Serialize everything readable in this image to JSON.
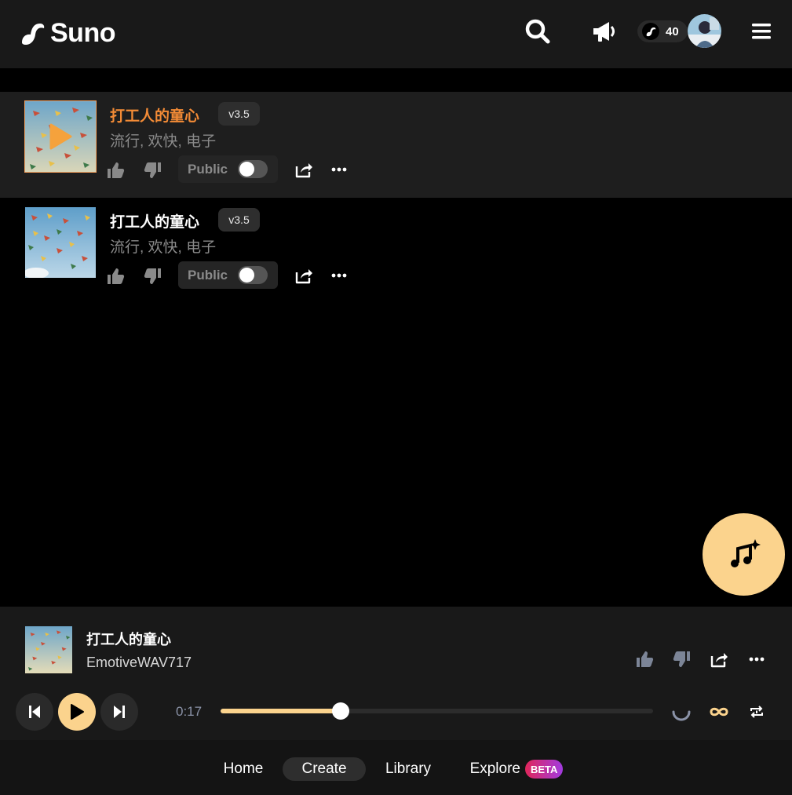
{
  "header": {
    "brand": "Suno",
    "credits": "40",
    "icons": [
      "search-icon",
      "megaphone-icon",
      "menu-icon"
    ]
  },
  "songs": [
    {
      "title": "打工人的童心",
      "version": "v3.5",
      "tags": "流行, 欢快, 电子",
      "visibility_label": "Public",
      "is_public": false,
      "selected": true
    },
    {
      "title": "打工人的童心",
      "version": "v3.5",
      "tags": "流行, 欢快, 电子",
      "visibility_label": "Public",
      "is_public": false,
      "selected": false
    }
  ],
  "player": {
    "title": "打工人的童心",
    "artist": "EmotiveWAV717",
    "current_time": "0:17",
    "progress_fraction": 0.277
  },
  "nav": {
    "items": [
      "Home",
      "Create",
      "Library",
      "Explore"
    ],
    "active": "Create",
    "beta_badge": "BETA"
  },
  "colors": {
    "accent": "#fbd38d",
    "active_title": "#f38b36",
    "background": "#000000"
  }
}
